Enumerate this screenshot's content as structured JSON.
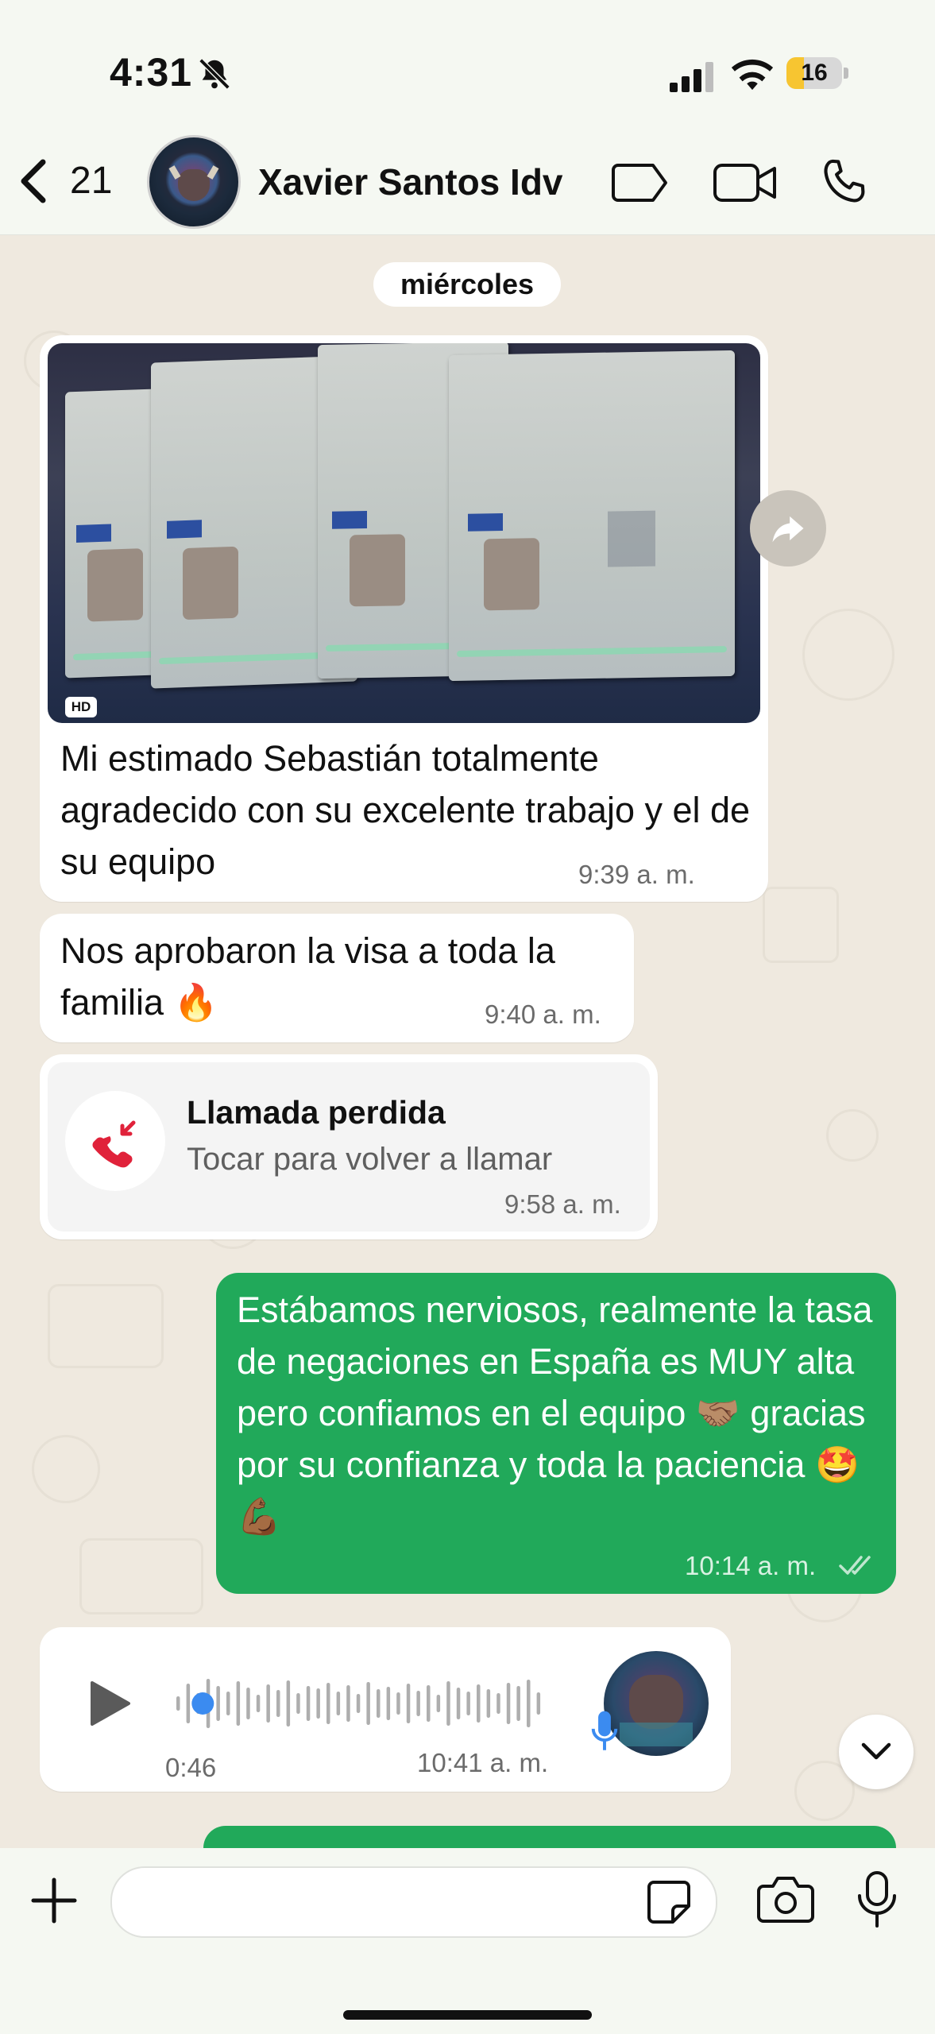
{
  "status_bar": {
    "time": "4:31",
    "battery_level": "16",
    "icons": [
      "bell-slash-icon",
      "signal-icon",
      "wifi-icon",
      "battery-icon"
    ]
  },
  "header": {
    "back_count": "21",
    "contact_name": "Xavier Santos Idv",
    "icons": [
      "chevron-left-icon",
      "label-icon",
      "video-call-icon",
      "phone-icon"
    ]
  },
  "chat": {
    "date_chip": "miércoles",
    "messages": [
      {
        "type": "image_text",
        "direction": "incoming",
        "badge": "HD",
        "text": "Mi estimado Sebastián totalmente agradecido con su excelente trabajo y el de su equipo",
        "time": "9:39",
        "period": "a. m."
      },
      {
        "type": "text",
        "direction": "incoming",
        "text": "Nos aprobaron la visa a toda la familia 🔥",
        "time": "9:40",
        "period": "a. m."
      },
      {
        "type": "missed_call",
        "direction": "incoming",
        "title": "Llamada perdida",
        "subtitle": "Tocar para volver a llamar",
        "time": "9:58",
        "period": "a. m."
      },
      {
        "type": "text",
        "direction": "outgoing",
        "text": "Estábamos nerviosos, realmente la tasa de negaciones en España es MUY alta pero confiamos en el equipo 🤝🏽 gracias por su confianza y toda la paciencia 🤩💪🏾",
        "time": "10:14",
        "period": "a. m.",
        "read": true
      },
      {
        "type": "voice_note",
        "direction": "incoming",
        "duration": "0:46",
        "time": "10:41",
        "period": "a. m.",
        "playback_progress": 0.05
      }
    ]
  },
  "footer": {
    "icons": [
      "plus-icon",
      "sticker-icon",
      "camera-icon",
      "microphone-icon"
    ],
    "input_value": ""
  },
  "colors": {
    "outgoing_bubble": "#21a95a",
    "chat_background": "#efe9df",
    "header_background": "#f5f8f2",
    "missed_call_red": "#e0223a",
    "voice_progress": "#3b8bf0"
  }
}
